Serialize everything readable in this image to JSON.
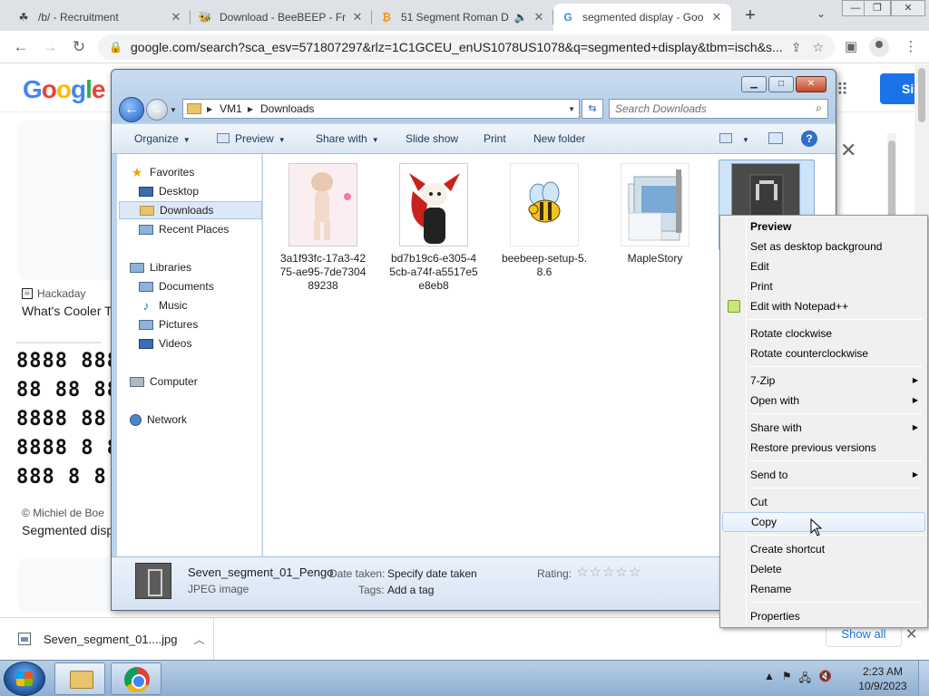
{
  "browser": {
    "tabs": [
      {
        "title": "/b/ - Recruitment",
        "icon": "clover-icon"
      },
      {
        "title": "Download - BeeBEEP - Fr",
        "icon": "beebeep-icon"
      },
      {
        "title": "51 Segment Roman D",
        "icon": "bitcoin-icon"
      },
      {
        "title": "segmented display - Goo",
        "icon": "google-g-icon"
      }
    ],
    "url": "google.com/search?sca_esv=571807297&rlz=1C1GCEU_enUS1078US1078&q=segmented+display&tbm=isch&s..."
  },
  "google": {
    "logo": "Google",
    "signin": "Si",
    "result1": {
      "source": "Hackaday",
      "title": "What's Cooler T"
    },
    "result2": {
      "source": "Michiel de Boe",
      "title": "Segmented disp"
    },
    "thumb_rows": [
      "8888 8888",
      "88 88 88",
      "8888 88",
      "8888 8 8",
      "888 8 8 8"
    ]
  },
  "downloads_bar": {
    "file": "Seven_segment_01....jpg",
    "show_all": "Show all"
  },
  "explorer": {
    "breadcrumb": [
      "VM1",
      "Downloads"
    ],
    "search_placeholder": "Search Downloads",
    "toolbar": {
      "organize": "Organize",
      "preview": "Preview",
      "share_with": "Share with",
      "slide_show": "Slide show",
      "print": "Print",
      "new_folder": "New folder"
    },
    "nav": {
      "favorites": "Favorites",
      "desktop": "Desktop",
      "downloads": "Downloads",
      "recent_places": "Recent Places",
      "libraries": "Libraries",
      "documents": "Documents",
      "music": "Music",
      "pictures": "Pictures",
      "videos": "Videos",
      "computer": "Computer",
      "network": "Network"
    },
    "files": [
      {
        "name": "3a1f93fc-17a3-4275-ae95-7de730489238"
      },
      {
        "name": "bd7b19c6-e305-45cb-a74f-a5517e5e8eb8"
      },
      {
        "name": "beebeep-setup-5.8.6"
      },
      {
        "name": "MapleStory"
      },
      {
        "name": "Seven_segment_01_Pengo"
      }
    ],
    "details": {
      "name": "Seven_segment_01_Pengo",
      "type": "JPEG image",
      "date_label": "Date taken:",
      "date_value": "Specify date taken",
      "tags_label": "Tags:",
      "tags_value": "Add a tag",
      "rating_label": "Rating:",
      "rating_value": 0,
      "rating_max": 5
    }
  },
  "context_menu": {
    "preview": "Preview",
    "set_bg": "Set as desktop background",
    "edit": "Edit",
    "print": "Print",
    "edit_npp": "Edit with Notepad++",
    "rotate_cw": "Rotate clockwise",
    "rotate_ccw": "Rotate counterclockwise",
    "zip": "7-Zip",
    "open_with": "Open with",
    "share_with": "Share with",
    "restore": "Restore previous versions",
    "send_to": "Send to",
    "cut": "Cut",
    "copy": "Copy",
    "create_shortcut": "Create shortcut",
    "delete": "Delete",
    "rename": "Rename",
    "properties": "Properties"
  },
  "taskbar": {
    "time": "2:23 AM",
    "date": "10/9/2023"
  }
}
